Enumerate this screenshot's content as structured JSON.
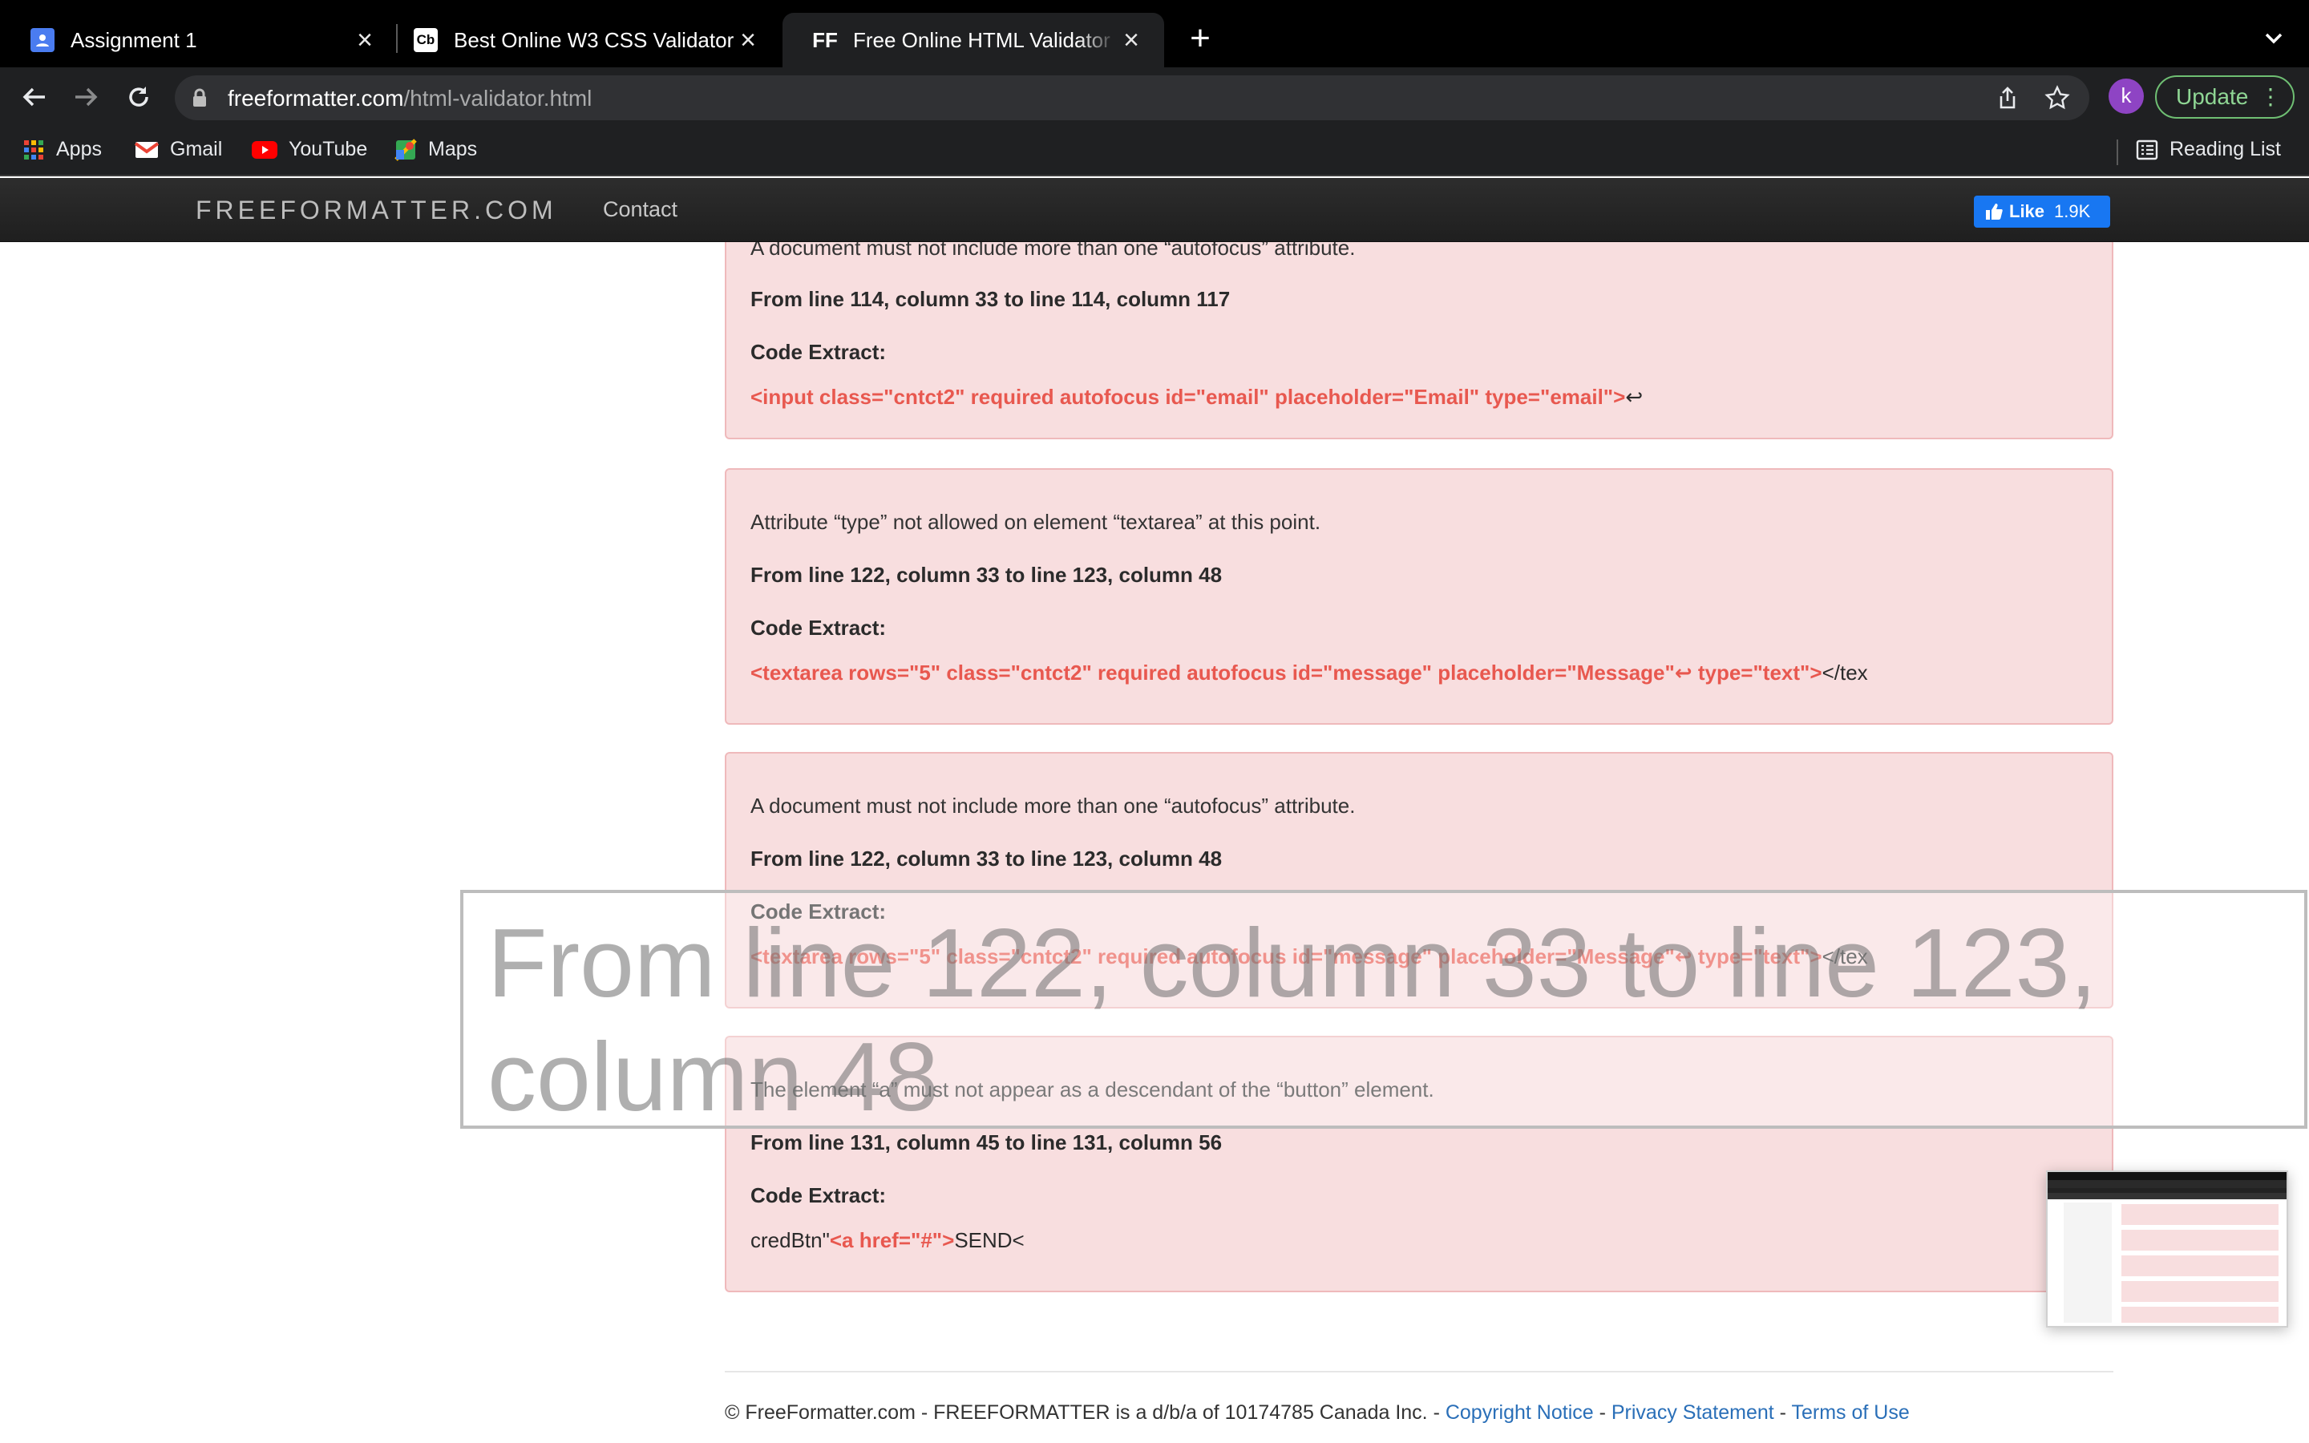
{
  "browser": {
    "tabs": [
      {
        "title": "Assignment 1",
        "icon": "contacts-icon",
        "favicon_text": ""
      },
      {
        "title": "Best Online W3 CSS Validator",
        "icon": "cb-favicon",
        "favicon_text": "Cb"
      },
      {
        "title": "Free Online HTML Validator - F",
        "icon": "ff-favicon",
        "favicon_text": "FF"
      }
    ],
    "url_host": "freeformatter.com",
    "url_path": "/html-validator.html",
    "avatar_letter": "k",
    "update_label": "Update",
    "bookmarks": [
      {
        "label": "Apps",
        "icon": "apps-grid-icon"
      },
      {
        "label": "Gmail",
        "icon": "gmail-icon"
      },
      {
        "label": "YouTube",
        "icon": "youtube-icon"
      },
      {
        "label": "Maps",
        "icon": "maps-icon"
      }
    ],
    "reading_list": "Reading List"
  },
  "site": {
    "brand": "FREEFORMATTER.COM",
    "nav_contact": "Contact",
    "like_label": "Like",
    "like_count": "1.9K"
  },
  "errors": [
    {
      "message": "A document must not include more than one “autofocus” attribute.",
      "location": "From line 114, column 33 to line 114, column 117",
      "code_label": "Code Extract:",
      "code_pre": "",
      "code_hl": "<input class=\"cntct2\" required autofocus id=\"email\" placeholder=\"Email\" type=\"email\">",
      "code_post": "↩"
    },
    {
      "message": "Attribute “type” not allowed on element “textarea” at this point.",
      "location": "From line 122, column 33 to line 123, column 48",
      "code_label": "Code Extract:",
      "code_pre": "",
      "code_hl": "<textarea rows=\"5\" class=\"cntct2\" required autofocus id=\"message\" placeholder=\"Message\"↩ type=\"text\">",
      "code_post": "</tex"
    },
    {
      "message": "A document must not include more than one “autofocus” attribute.",
      "location": "From line 122, column 33 to line 123, column 48",
      "code_label": "Code Extract:",
      "code_pre": "",
      "code_hl": "<textarea rows=\"5\" class=\"cntct2\" required autofocus id=\"message\" placeholder=\"Message\"↩ type=\"text\">",
      "code_post": "</tex"
    },
    {
      "message": "The element “a” must not appear as a descendant of the “button” element.",
      "location": "From line 131, column 45 to line 131, column 56",
      "code_label": "Code Extract:",
      "code_pre": "credBtn\"",
      "code_hl": "<a href=\"#\">",
      "code_post": "SEND<"
    }
  ],
  "footer": {
    "text": "© FreeFormatter.com - FREEFORMATTER is a d/b/a of 10174785 Canada Inc. - ",
    "copyright": "Copyright Notice",
    "sep1": " - ",
    "privacy": "Privacy Statement",
    "sep2": " - ",
    "terms": "Terms of Use"
  },
  "magnifier_text": "From line 122, column 33 to line 123, column 48",
  "colors": {
    "error_bg": "#f8dedf",
    "error_border": "#efb9bb",
    "code_highlight": "#e8584f",
    "link": "#2a6fb8",
    "update_green": "#8fd694"
  }
}
